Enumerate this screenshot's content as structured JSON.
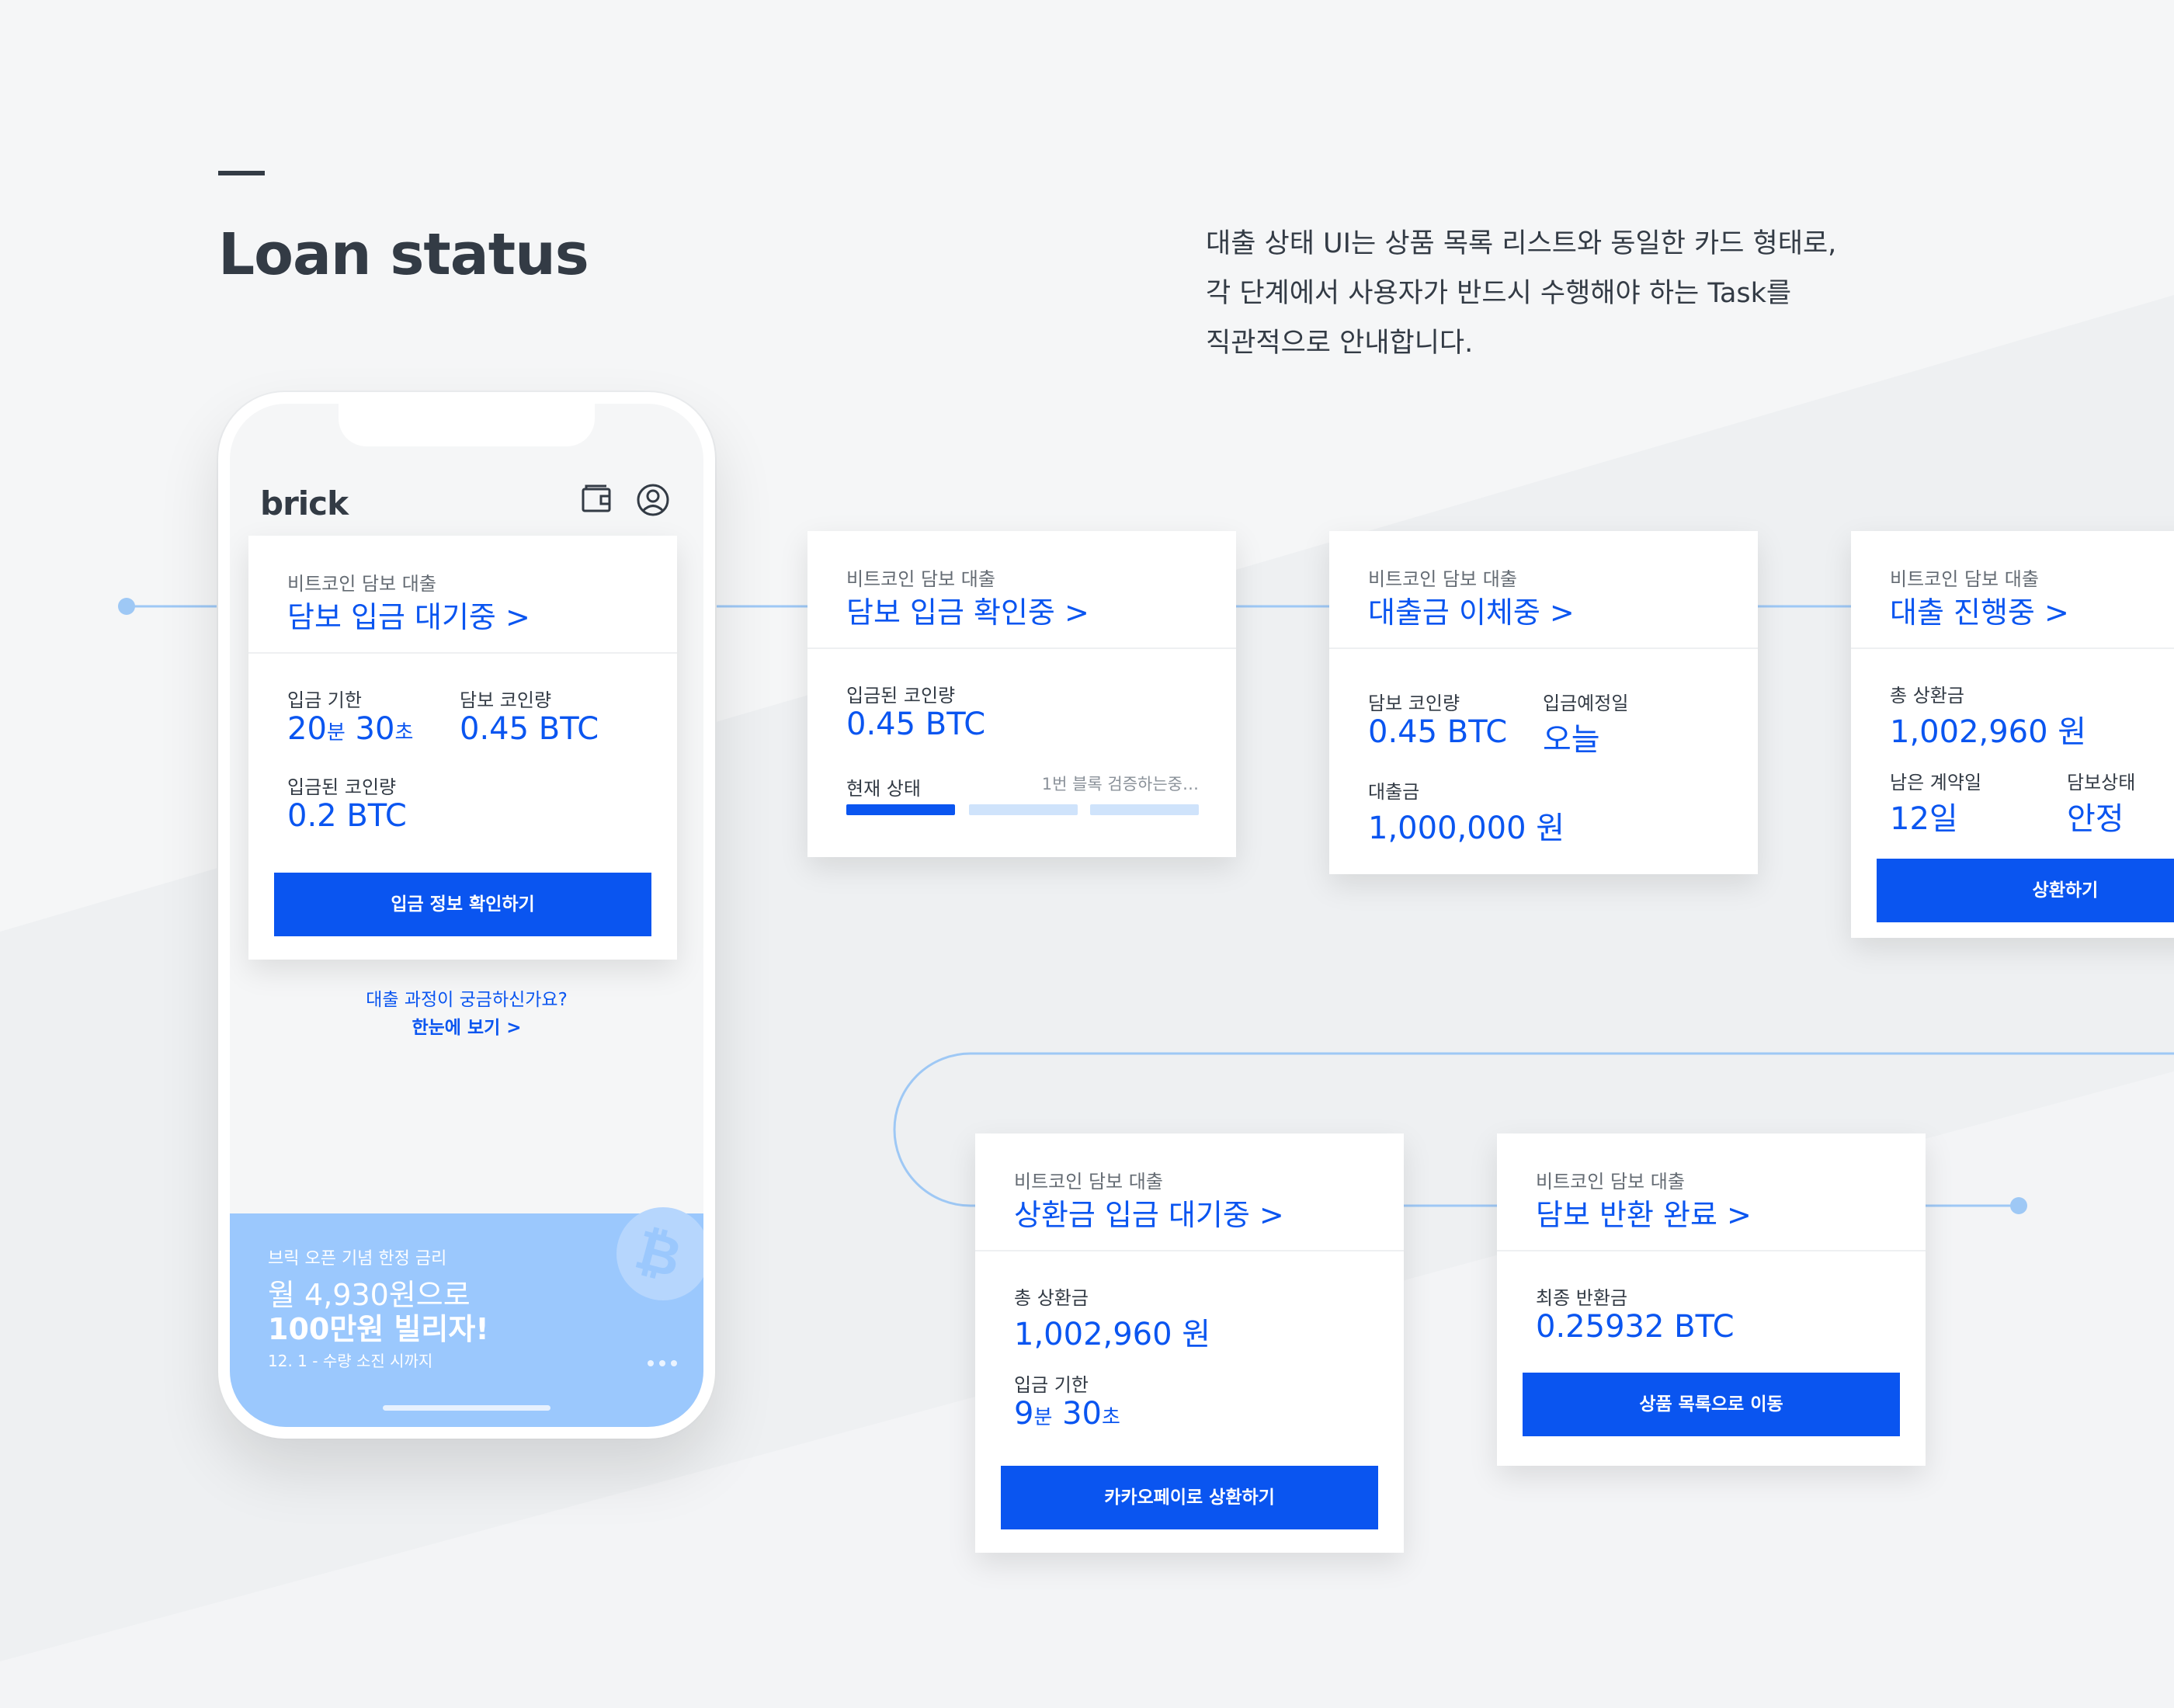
{
  "page": {
    "title": "Loan status",
    "description": [
      "대출 상태 UI는 상품 목록 리스트와 동일한 카드 형태로,",
      "각 단계에서 사용자가 반드시 수행해야 하는 Task를",
      "직관적으로 안내합니다."
    ]
  },
  "colors": {
    "accent": "#0a55f0",
    "line": "#9ec8f5",
    "banner": "#9bc8fd",
    "text": "#333b45"
  },
  "phone": {
    "logo": "brick",
    "icons": [
      "wallet-icon",
      "profile-icon"
    ],
    "card": {
      "category": "비트코인 담보 대출",
      "status": "담보 입금 대기중 >",
      "deadline_label": "입금 기한",
      "deadline_min": "20",
      "min_unit": "분",
      "deadline_sec": " 30",
      "sec_unit": "초",
      "collateral_label": "담보 코인량",
      "collateral_value": "0.45 BTC",
      "deposited_label": "입금된 코인량",
      "deposited_value": "0.2 BTC",
      "button": "입금 정보 확인하기"
    },
    "help_question": "대출 과정이 궁금하신가요?",
    "help_link": "한눈에 보기 >",
    "banner": {
      "small": "브릭 오픈 기념 한정 금리",
      "line1": "월 4,930원으로",
      "line2": "100만원 빌리자!",
      "date": "12. 1 - 수량 소진 시까지"
    }
  },
  "cards": {
    "confirming": {
      "category": "비트코인 담보 대출",
      "status": "담보 입금 확인중 >",
      "deposited_label": "입금된 코인량",
      "deposited_value": "0.45 BTC",
      "current_label": "현재 상태",
      "progress_text": "1번 블록 검증하는중…",
      "progress_steps_done": 1,
      "progress_steps_total": 3
    },
    "transferring": {
      "category": "비트코인 담보 대출",
      "status": "대출금 이체중 >",
      "collateral_label": "담보 코인량",
      "collateral_value": "0.45 BTC",
      "expected_label": "입금예정일",
      "expected_value": "오늘",
      "loan_label": "대출금",
      "loan_value": "1,000,000 원"
    },
    "in_progress": {
      "category": "비트코인 담보 대출",
      "status": "대출 진행중 >",
      "total_label": "총 상환금",
      "total_value": "1,002,960 원",
      "days_label": "남은 계약일",
      "days_value": "12일",
      "collateral_state_label": "담보상태",
      "collateral_state_value": "안정",
      "button": "상환하기"
    },
    "repay_waiting": {
      "category": "비트코인 담보 대출",
      "status": "상환금 입금 대기중 >",
      "total_label": "총 상환금",
      "total_value": "1,002,960 원",
      "deadline_label": "입금 기한",
      "deadline_min": "9",
      "min_unit": "분",
      "deadline_sec": " 30",
      "sec_unit": "초",
      "button": "카카오페이로 상환하기"
    },
    "returned": {
      "category": "비트코인 담보 대출",
      "status": "담보 반환 완료 >",
      "final_label": "최종 반환금",
      "final_value": "0.25932 BTC",
      "button": "상품 목록으로 이동"
    }
  }
}
